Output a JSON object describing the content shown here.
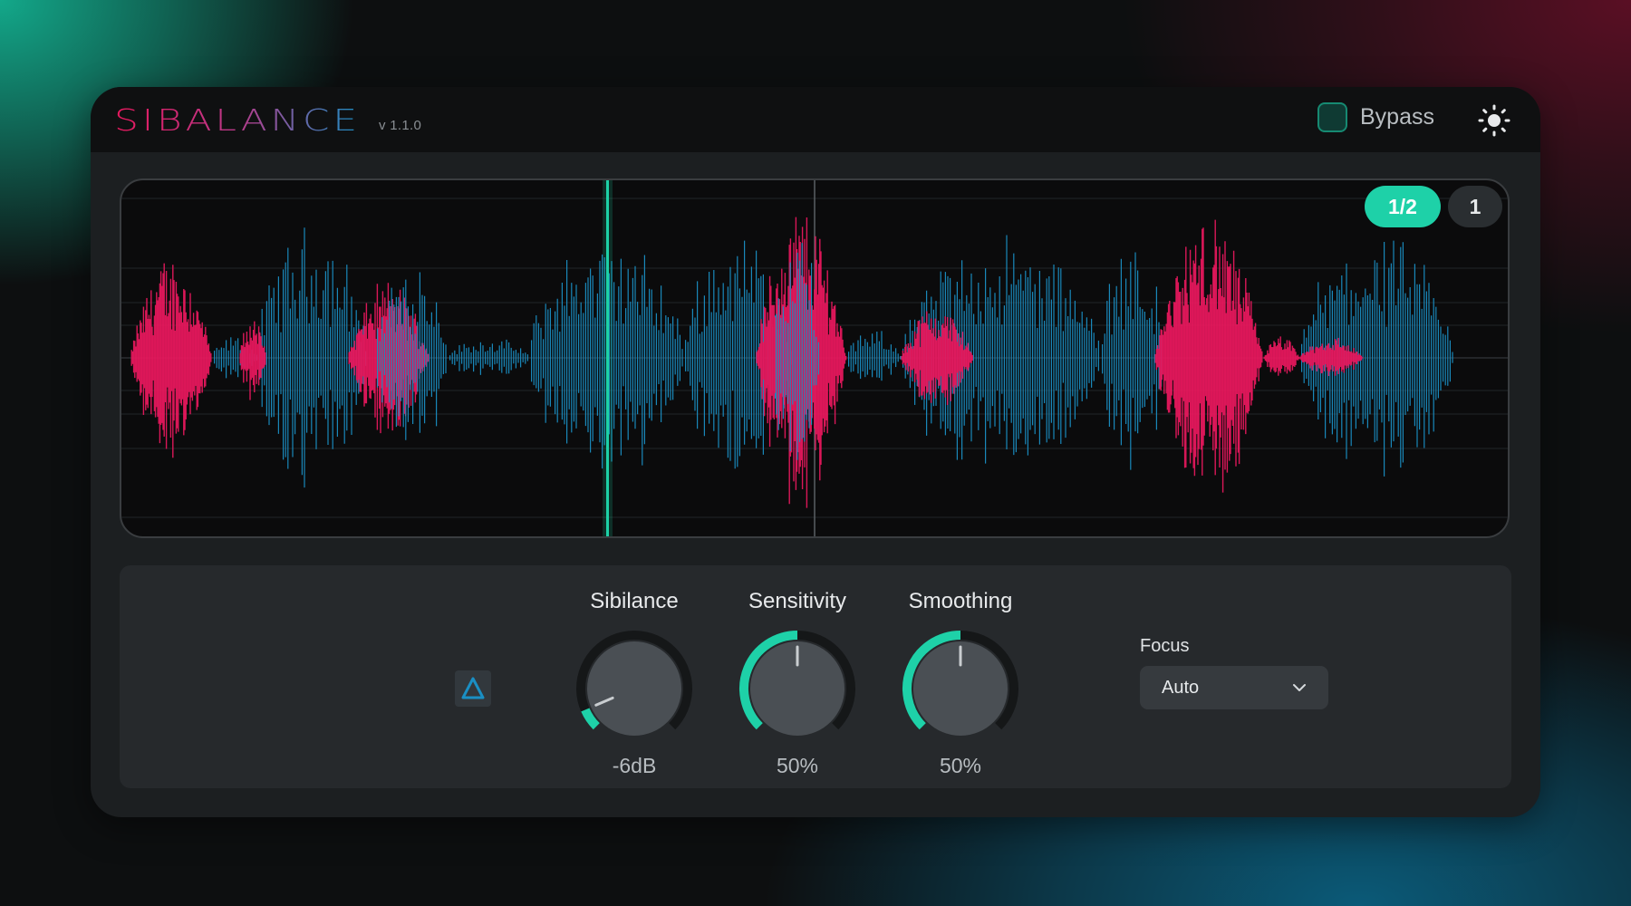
{
  "app": {
    "title_left": "SI",
    "title_right": "BALANCE",
    "version": "v 1.1.0"
  },
  "header": {
    "bypass_label": "Bypass",
    "theme_icon": "sun-icon"
  },
  "waveform": {
    "zoom_options": [
      "1/2",
      "1"
    ],
    "selected_zoom": "1/2",
    "colors": {
      "sibilance": "#e6185d",
      "voice": "#1a8fc4",
      "playhead": "#1ed1a8"
    }
  },
  "controls": {
    "delta_icon": "delta-icon",
    "sibilance": {
      "label": "Sibilance",
      "value": "-6dB",
      "level": 0.08
    },
    "sensitivity": {
      "label": "Sensitivity",
      "value": "50%",
      "level": 0.5
    },
    "smoothing": {
      "label": "Smoothing",
      "value": "50%",
      "level": 0.5
    },
    "focus": {
      "label": "Focus",
      "value": "Auto"
    }
  },
  "colors": {
    "accent": "#1ed1a8",
    "pink": "#e6185d",
    "blue": "#1a8fc4"
  }
}
